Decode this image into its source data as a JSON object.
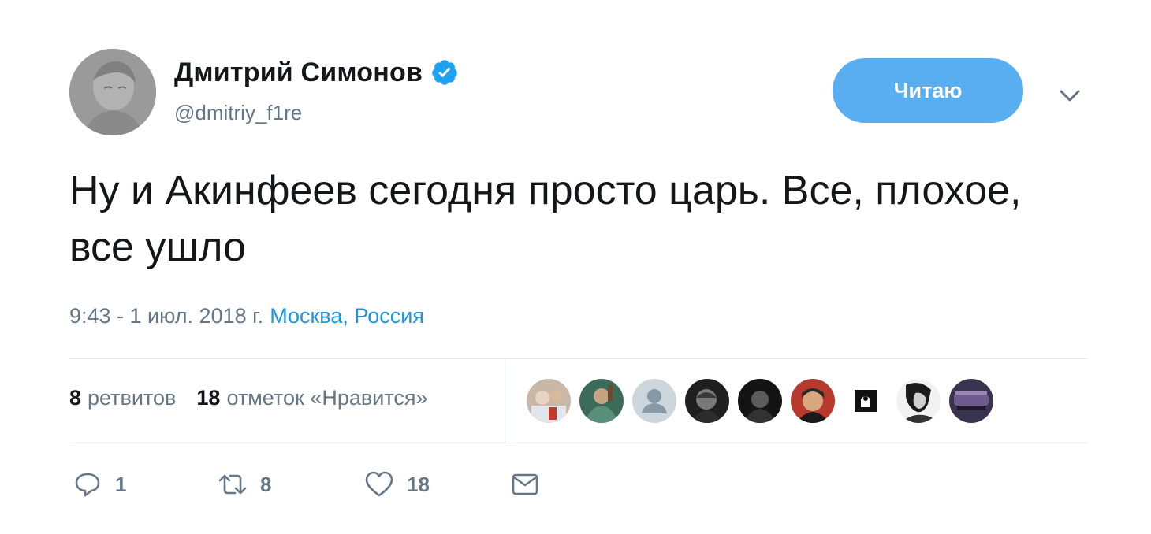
{
  "user": {
    "display_name": "Дмитрий Симонов",
    "handle": "@dmitriy_f1re",
    "verified": true,
    "avatar_icon": "profile-photo"
  },
  "follow_button": {
    "label": "Читаю"
  },
  "tweet": {
    "text": "Ну и Акинфеев сегодня просто царь. Все, плохое, все ушло",
    "time": "9:43 - 1 июл. 2018 г.",
    "location": "Москва, Россия"
  },
  "stats": {
    "retweets_count": "8",
    "retweets_label": "ретвитов",
    "likes_count": "18",
    "likes_label": "отметок «Нравится»"
  },
  "likers_count_shown": 9,
  "actions": {
    "reply_count": "1",
    "retweet_count": "8",
    "like_count": "18"
  },
  "colors": {
    "accent": "#58aef0",
    "link": "#1b95e0",
    "muted": "#657786",
    "text": "#14171a",
    "divider": "#e1e8ed"
  }
}
